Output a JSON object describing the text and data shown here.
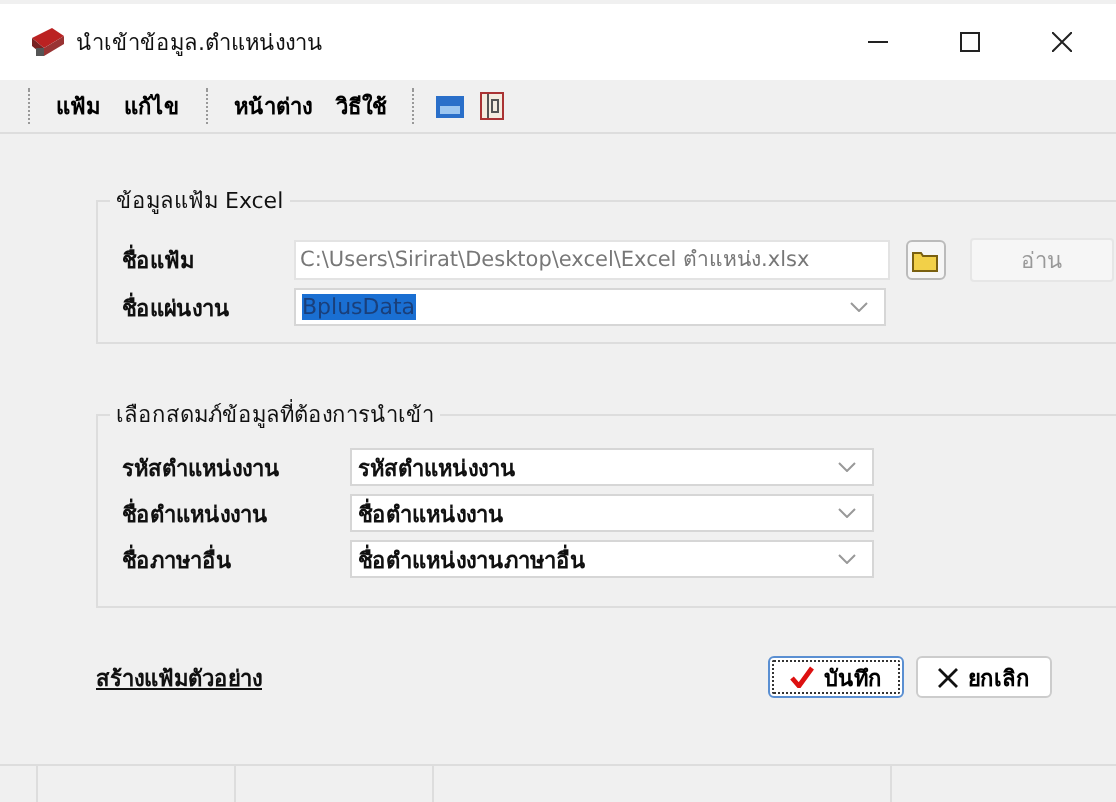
{
  "window": {
    "title": "นำเข้าข้อมูล.ตำแหน่งงาน"
  },
  "menu": [
    {
      "label": "แฟ้ม"
    },
    {
      "label": "แก้ไข"
    },
    {
      "label": "หน้าต่าง"
    },
    {
      "label": "วิธีใช้"
    }
  ],
  "file_group": {
    "title": "ข้อมูลแฟ้ม Excel",
    "file_label": "ชื่อแฟ้ม",
    "file_value": "C:\\Users\\Sirirat\\Desktop\\excel\\Excel ตำแหน่ง.xlsx",
    "read_button": {
      "label": "อ่าน",
      "disabled": true
    },
    "sheet_label": "ชื่อแผ่นงาน",
    "sheet_value": "BplusData"
  },
  "mapping_group": {
    "title": "เลือกสดมภ์ข้อมูลที่ต้องการนำเข้า",
    "rows": [
      {
        "label": "รหัสตำแหน่งงาน",
        "value": "รหัสตำแหน่งงาน"
      },
      {
        "label": "ชื่อตำแหน่งงาน",
        "value": "ชื่อตำแหน่งงาน"
      },
      {
        "label": "ชื่อภาษาอื่น",
        "value": "ชื่อตำแหน่งงานภาษาอื่น"
      }
    ]
  },
  "sample_link": "สร้างแฟ้มตัวอย่าง",
  "buttons": [
    {
      "kind": "save",
      "label": "บันทึก",
      "selected": true
    },
    {
      "kind": "cancel",
      "label": "ยกเลิก",
      "selected": false
    }
  ]
}
